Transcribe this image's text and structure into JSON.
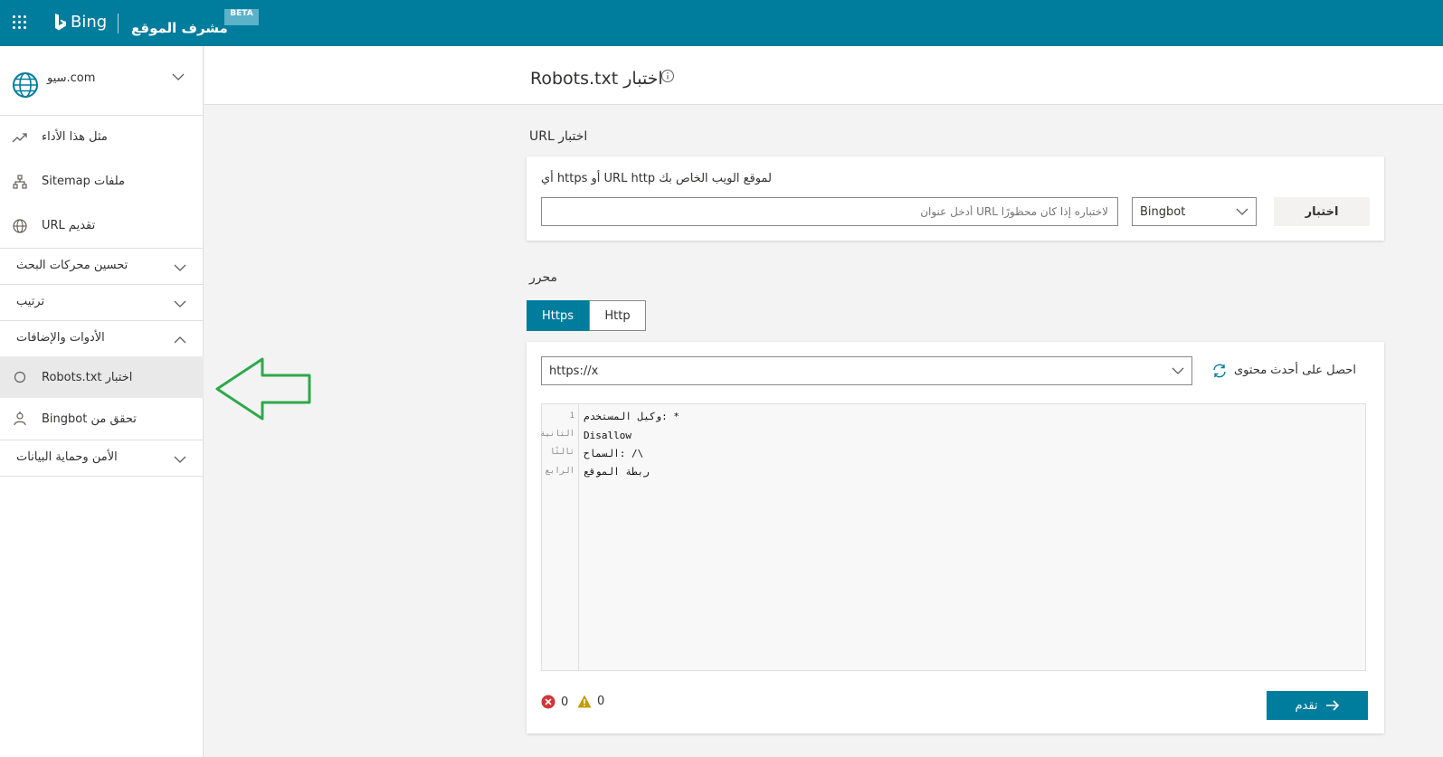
{
  "header": {
    "brand": "Bing",
    "app_title": "مشرف الموقع",
    "beta_badge": "BETA"
  },
  "sidebar": {
    "site_name": "سيو.com",
    "items": [
      {
        "label": "مثل هذا الأداء",
        "icon": "trend-icon"
      },
      {
        "label": "ملفات Sitemap",
        "icon": "sitemap-icon"
      },
      {
        "label": "تقديم URL",
        "icon": "globe-icon"
      }
    ],
    "groups": [
      {
        "label": "تحسين محركات البحث",
        "expanded": false
      },
      {
        "label": "ترتيب",
        "expanded": false
      },
      {
        "label": "الأدوات والإضافات",
        "expanded": true
      }
    ],
    "tool_items": [
      {
        "label": "اختبار Robots.txt",
        "icon": "circle-icon",
        "active": true
      },
      {
        "label": "تحقق من Bingbot",
        "icon": "bot-icon",
        "active": false
      }
    ],
    "last_group": {
      "label": "الأمن وحماية البيانات",
      "expanded": false
    }
  },
  "main": {
    "page_title": "اختبار Robots.txt",
    "url_test": {
      "section_label": "اختبار URL",
      "description": "لموقع الويب الخاص بك URL http أو https أي",
      "input_placeholder": "لاختباره إذا كان محظورًا URL أدخل عنوان",
      "user_agent": "Bingbot",
      "test_button": "اختبار"
    },
    "editor": {
      "section_label": "محرر",
      "tabs": [
        {
          "label": "Https",
          "selected": true
        },
        {
          "label": "Http",
          "selected": false
        }
      ],
      "url_value": "https://x",
      "refresh_label": "احصل على أحدث محتوى",
      "lines": [
        {
          "num": "1",
          "text": "وكيل المستخدم: *"
        },
        {
          "num": "الثانية",
          "text": "Disallow"
        },
        {
          "num": "ثالثًا",
          "text": "السماح: /\\"
        },
        {
          "num": "الرابع",
          "text": "ربطة الموقع"
        }
      ],
      "errors": "0",
      "warnings": "0",
      "submit_button": "تقدم"
    }
  },
  "colors": {
    "brand": "#007c9c",
    "annotation_arrow": "#2ea84a",
    "error": "#d13438",
    "warning": "#c19c00"
  }
}
